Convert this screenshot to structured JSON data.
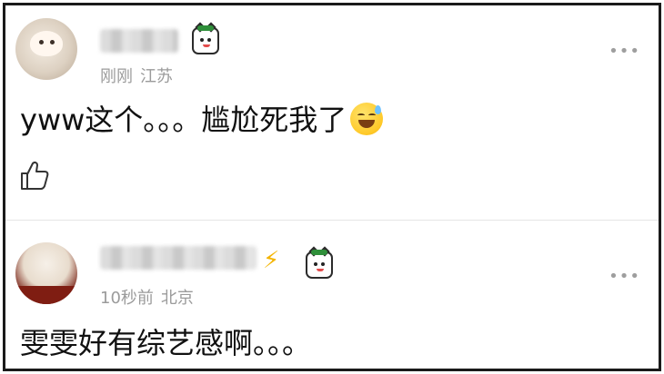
{
  "comments": [
    {
      "time": "刚刚",
      "location": "江苏",
      "text": "yww这个。。。尴尬死我了",
      "emoji": "sweat-smile-emoji",
      "more": "•••"
    },
    {
      "time": "10秒前",
      "location": "北京",
      "text": "雯雯好有综艺感啊。。。",
      "badge_extra": "⚡",
      "more": "•••"
    }
  ]
}
